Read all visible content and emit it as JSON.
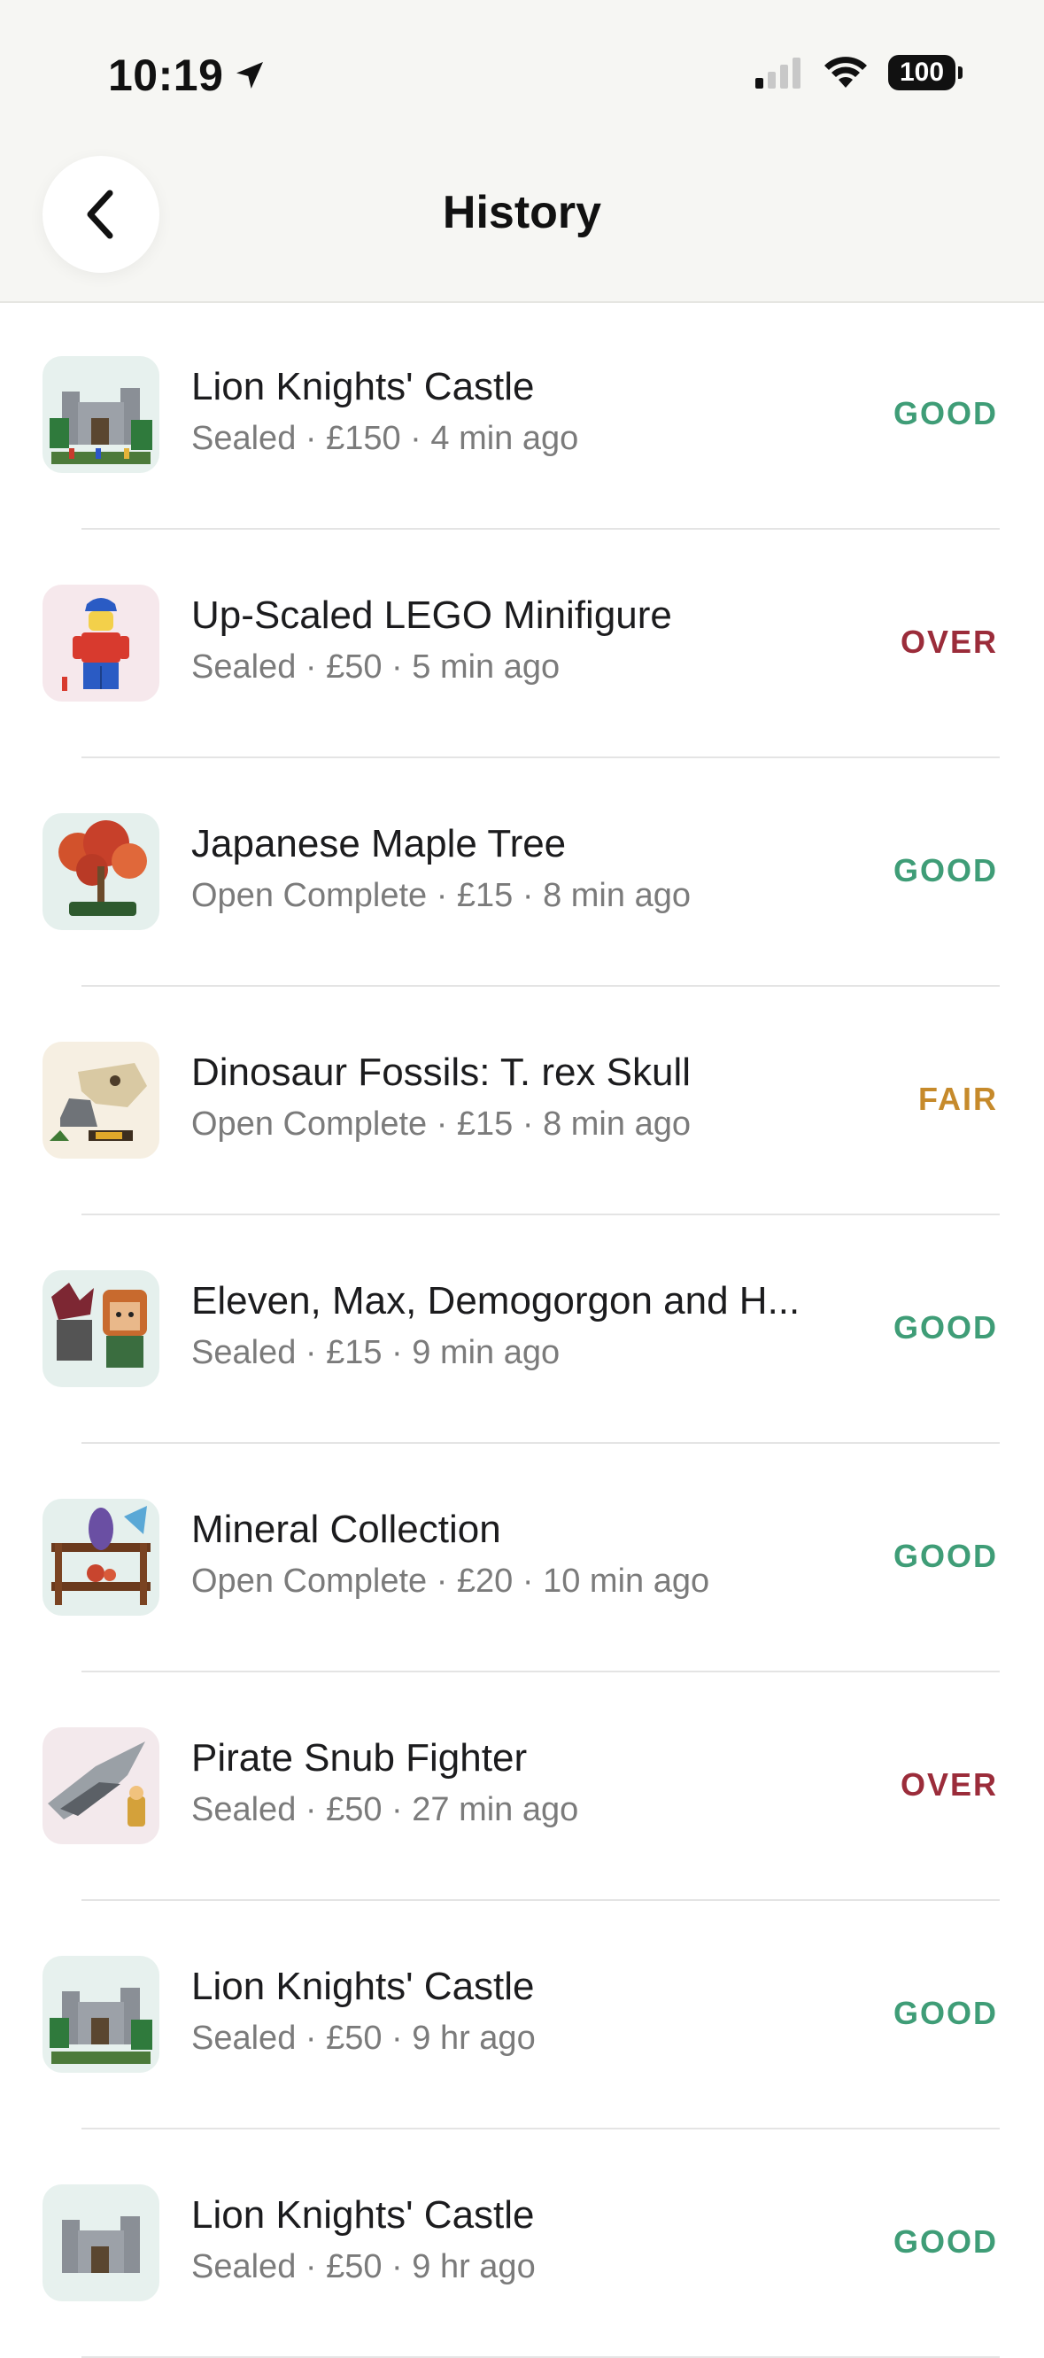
{
  "status_bar": {
    "time": "10:19",
    "battery": "100"
  },
  "header": {
    "title": "History"
  },
  "colors": {
    "good": "#3f9d77",
    "over": "#9b2c3a",
    "fair": "#c68a2b"
  },
  "items": [
    {
      "title": "Lion Knights' Castle",
      "subtitle": "Sealed · £150 · 4 min ago",
      "rating": "GOOD",
      "icon": "castle-thumbnail"
    },
    {
      "title": "Up-Scaled LEGO Minifigure",
      "subtitle": "Sealed · £50 · 5 min ago",
      "rating": "OVER",
      "icon": "minifigure-thumbnail"
    },
    {
      "title": "Japanese Maple Tree",
      "subtitle": "Open Complete · £15 · 8 min ago",
      "rating": "GOOD",
      "icon": "maple-tree-thumbnail"
    },
    {
      "title": "Dinosaur Fossils: T. rex Skull",
      "subtitle": "Open Complete · £15 · 8 min ago",
      "rating": "FAIR",
      "icon": "trex-skull-thumbnail"
    },
    {
      "title": "Eleven, Max, Demogorgon and H...",
      "subtitle": "Sealed · £15 · 9 min ago",
      "rating": "GOOD",
      "icon": "brickheadz-thumbnail"
    },
    {
      "title": "Mineral Collection",
      "subtitle": "Open Complete · £20 · 10 min ago",
      "rating": "GOOD",
      "icon": "mineral-thumbnail"
    },
    {
      "title": "Pirate Snub Fighter",
      "subtitle": "Sealed · £50 · 27 min ago",
      "rating": "OVER",
      "icon": "snub-fighter-thumbnail"
    },
    {
      "title": "Lion Knights' Castle",
      "subtitle": "Sealed · £50 · 9 hr ago",
      "rating": "GOOD",
      "icon": "castle-thumbnail"
    },
    {
      "title": "Lion Knights' Castle",
      "subtitle": "Sealed · £50 · 9 hr ago",
      "rating": "GOOD",
      "icon": "castle-thumbnail"
    }
  ]
}
